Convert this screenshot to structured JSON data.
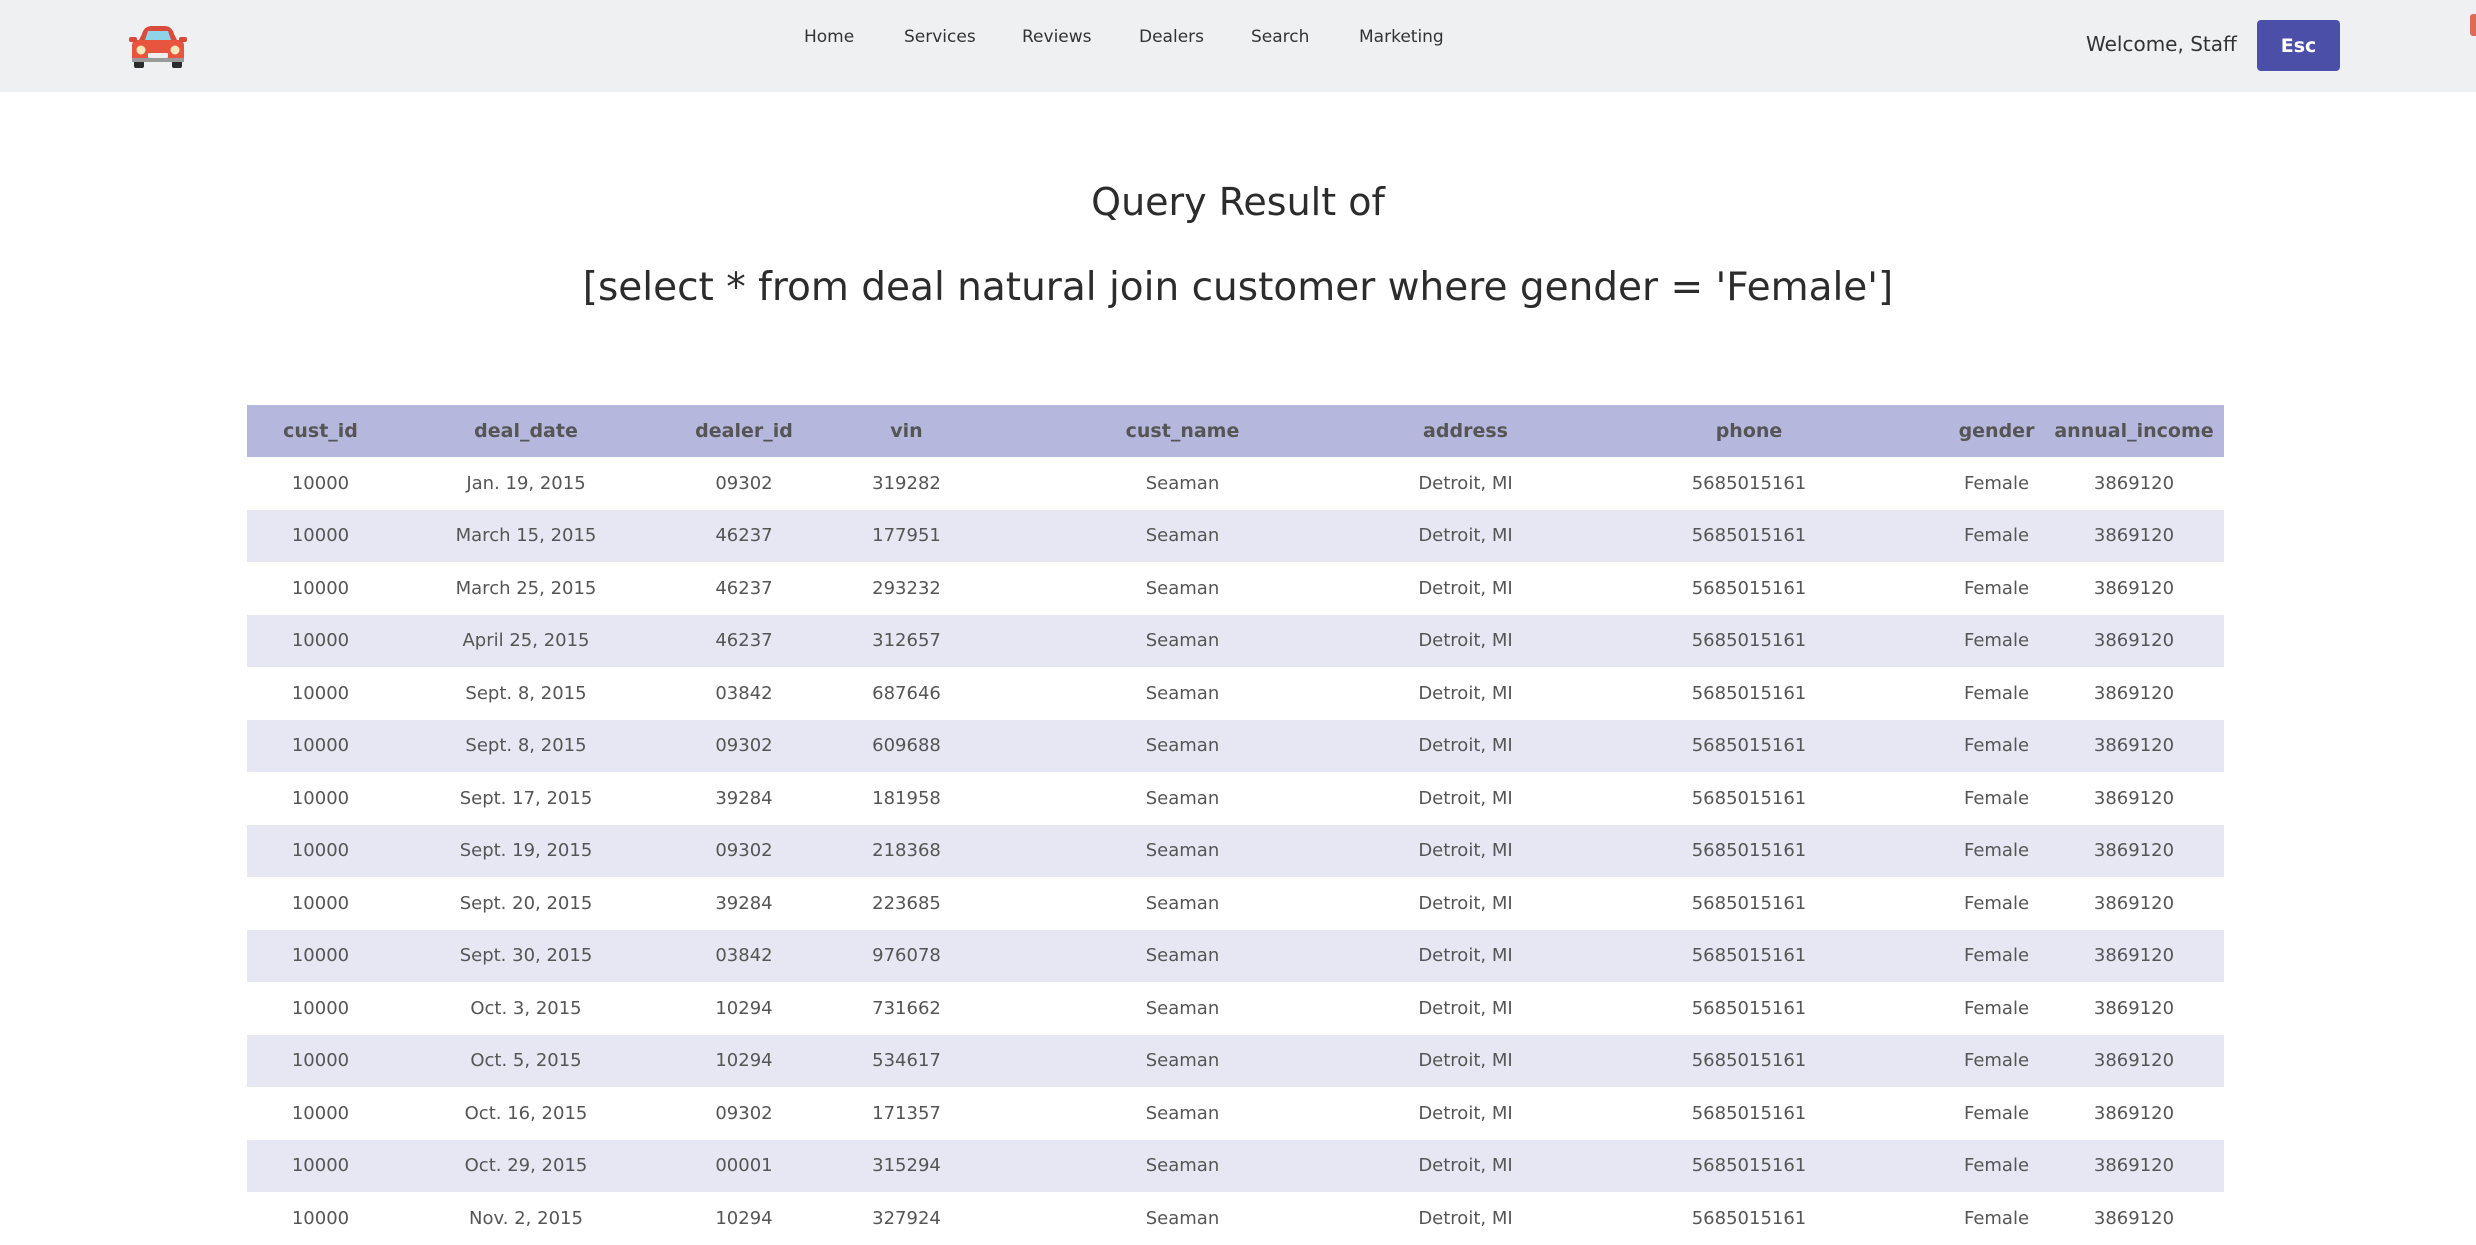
{
  "header": {
    "logo_icon": "red-car-icon",
    "nav": [
      "Home",
      "Services",
      "Reviews",
      "Dealers",
      "Search",
      "Marketing"
    ],
    "welcome": "Welcome, Staff",
    "esc_label": "Esc",
    "colors": {
      "bar_bg": "#eef0f2",
      "button_bg": "#4c4fa8"
    }
  },
  "page": {
    "title_line1": "Query Result of",
    "title_line2": "[select * from deal natural join customer where gender = 'Female']"
  },
  "table": {
    "header_color": "#b6b7dd",
    "stripe_color": "#e6e7f2",
    "columns": [
      "cust_id",
      "deal_date",
      "dealer_id",
      "vin",
      "cust_name",
      "address",
      "phone",
      "gender",
      "annual_income"
    ],
    "rows": [
      [
        "10000",
        "Jan. 19, 2015",
        "09302",
        "319282",
        "Seaman",
        "Detroit, MI",
        "5685015161",
        "Female",
        "3869120"
      ],
      [
        "10000",
        "March 15, 2015",
        "46237",
        "177951",
        "Seaman",
        "Detroit, MI",
        "5685015161",
        "Female",
        "3869120"
      ],
      [
        "10000",
        "March 25, 2015",
        "46237",
        "293232",
        "Seaman",
        "Detroit, MI",
        "5685015161",
        "Female",
        "3869120"
      ],
      [
        "10000",
        "April 25, 2015",
        "46237",
        "312657",
        "Seaman",
        "Detroit, MI",
        "5685015161",
        "Female",
        "3869120"
      ],
      [
        "10000",
        "Sept. 8, 2015",
        "03842",
        "687646",
        "Seaman",
        "Detroit, MI",
        "5685015161",
        "Female",
        "3869120"
      ],
      [
        "10000",
        "Sept. 8, 2015",
        "09302",
        "609688",
        "Seaman",
        "Detroit, MI",
        "5685015161",
        "Female",
        "3869120"
      ],
      [
        "10000",
        "Sept. 17, 2015",
        "39284",
        "181958",
        "Seaman",
        "Detroit, MI",
        "5685015161",
        "Female",
        "3869120"
      ],
      [
        "10000",
        "Sept. 19, 2015",
        "09302",
        "218368",
        "Seaman",
        "Detroit, MI",
        "5685015161",
        "Female",
        "3869120"
      ],
      [
        "10000",
        "Sept. 20, 2015",
        "39284",
        "223685",
        "Seaman",
        "Detroit, MI",
        "5685015161",
        "Female",
        "3869120"
      ],
      [
        "10000",
        "Sept. 30, 2015",
        "03842",
        "976078",
        "Seaman",
        "Detroit, MI",
        "5685015161",
        "Female",
        "3869120"
      ],
      [
        "10000",
        "Oct. 3, 2015",
        "10294",
        "731662",
        "Seaman",
        "Detroit, MI",
        "5685015161",
        "Female",
        "3869120"
      ],
      [
        "10000",
        "Oct. 5, 2015",
        "10294",
        "534617",
        "Seaman",
        "Detroit, MI",
        "5685015161",
        "Female",
        "3869120"
      ],
      [
        "10000",
        "Oct. 16, 2015",
        "09302",
        "171357",
        "Seaman",
        "Detroit, MI",
        "5685015161",
        "Female",
        "3869120"
      ],
      [
        "10000",
        "Oct. 29, 2015",
        "00001",
        "315294",
        "Seaman",
        "Detroit, MI",
        "5685015161",
        "Female",
        "3869120"
      ],
      [
        "10000",
        "Nov. 2, 2015",
        "10294",
        "327924",
        "Seaman",
        "Detroit, MI",
        "5685015161",
        "Female",
        "3869120"
      ]
    ]
  }
}
